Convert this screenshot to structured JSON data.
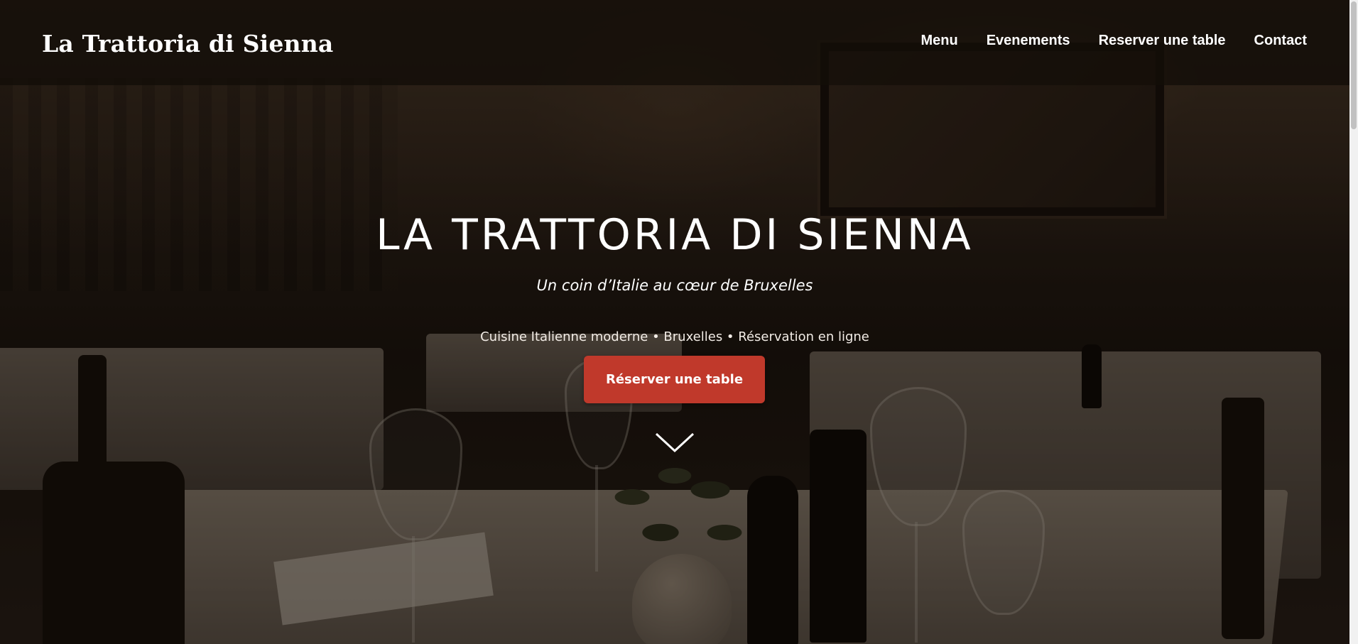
{
  "header": {
    "brand": "La Trattoria di Sienna",
    "nav": [
      {
        "label": "Menu"
      },
      {
        "label": "Evenements"
      },
      {
        "label": "Reserver une table"
      },
      {
        "label": "Contact"
      }
    ]
  },
  "hero": {
    "title": "LA TRATTORIA DI SIENNA",
    "subtitle": "Un coin d’Italie au cœur de Bruxelles",
    "tagline": "Cuisine Italienne moderne • Bruxelles • Réservation en ligne",
    "cta_label": "Réserver une table",
    "scroll_icon": "chevron-down-icon"
  },
  "colors": {
    "accent": "#c0392b",
    "text": "#ffffff",
    "header_bg": "#140e09"
  }
}
